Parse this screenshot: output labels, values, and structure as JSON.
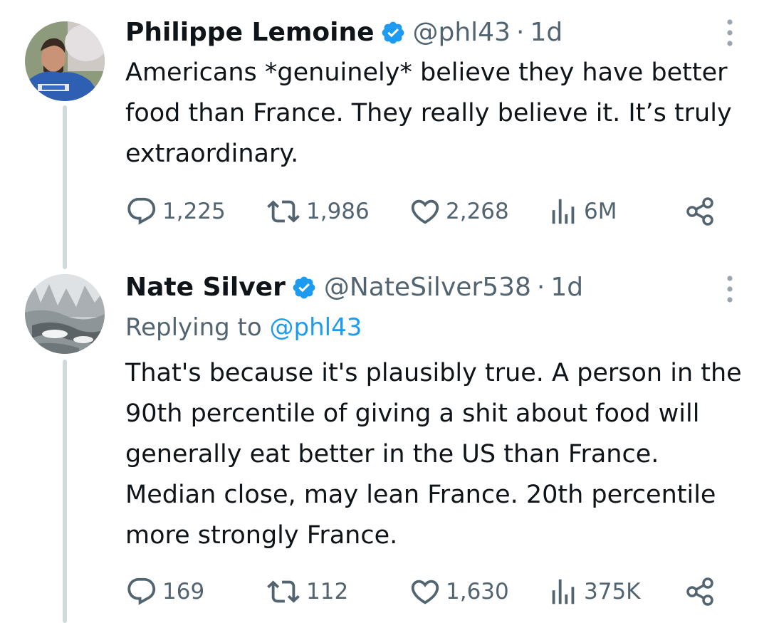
{
  "tweets": [
    {
      "author": {
        "name": "Philippe Lemoine",
        "handle": "@phl43",
        "verified": true
      },
      "separator": "·",
      "time": "1d",
      "text": "Americans *genuinely* believe they have better food than France. They really believe it. It’s truly extraordinary.",
      "stats": {
        "replies": "1,225",
        "retweets": "1,986",
        "likes": "2,268",
        "views": "6M"
      }
    },
    {
      "author": {
        "name": "Nate Silver",
        "handle": "@NateSilver538",
        "verified": true
      },
      "separator": "·",
      "time": "1d",
      "replying_label": "Replying to",
      "replying_to": "@phl43",
      "text": "That's because it's plausibly true. A person in the 90th percentile of giving a shit about food will generally eat better in the US than France. Median close, may lean France. 20th percentile more strongly France.",
      "stats": {
        "replies": "169",
        "retweets": "112",
        "likes": "1,630",
        "views": "375K"
      }
    }
  ],
  "colors": {
    "text": "#0f1419",
    "secondary": "#536471",
    "accent": "#1d9bf0",
    "thread_line": "#cfd9de"
  },
  "icons": [
    "verified-badge-icon",
    "more-options-icon",
    "reply-icon",
    "retweet-icon",
    "like-icon",
    "views-icon",
    "share-icon"
  ]
}
